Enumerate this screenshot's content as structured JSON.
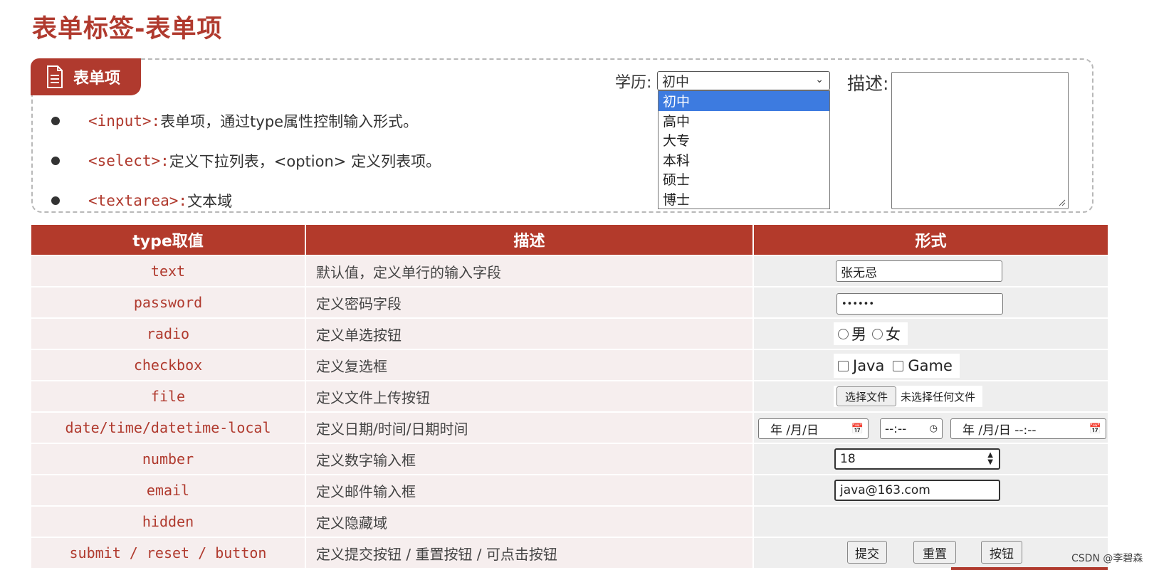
{
  "page_title": "表单标签-表单项",
  "panel": {
    "tab_label": "表单项",
    "bullets": [
      {
        "code": "<input>:",
        "text": " 表单项，通过type属性控制输入形式。"
      },
      {
        "code": "<select>:",
        "text": " 定义下拉列表，<option> 定义列表项。"
      },
      {
        "code": "<textarea>:",
        "text": " 文本域"
      }
    ],
    "select_label": "学历:",
    "select_value": "初中",
    "select_options": [
      "初中",
      "高中",
      "大专",
      "本科",
      "硕士",
      "博士"
    ],
    "textarea_label": "描述:"
  },
  "table": {
    "headers": [
      "type取值",
      "描述",
      "形式"
    ],
    "rows": [
      {
        "type": "text",
        "desc": "默认值，定义单行的输入字段"
      },
      {
        "type": "password",
        "desc": "定义密码字段"
      },
      {
        "type": "radio",
        "desc": "定义单选按钮"
      },
      {
        "type": "checkbox",
        "desc": "定义复选框"
      },
      {
        "type": "file",
        "desc": "定义文件上传按钮"
      },
      {
        "type": "date/time/datetime-local",
        "desc": "定义日期/时间/日期时间"
      },
      {
        "type": "number",
        "desc": "定义数字输入框"
      },
      {
        "type": "email",
        "desc": "定义邮件输入框"
      },
      {
        "type": "hidden",
        "desc": "定义隐藏域"
      },
      {
        "type": "submit / reset / button",
        "desc": "定义提交按钮 / 重置按钮 / 可点击按钮"
      }
    ],
    "demo": {
      "text_value": "张无忌",
      "password_mask": "••••••",
      "radio_options": [
        "男",
        "女"
      ],
      "checkbox_options": [
        "Java",
        "Game"
      ],
      "file_button": "选择文件",
      "file_status": "未选择任何文件",
      "date_placeholder": "年 /月/日",
      "time_placeholder": "--:--",
      "datetime_placeholder": "年 /月/日 --:--",
      "number_value": "18",
      "email_value": "java@163.com",
      "submit_label": "提交",
      "reset_label": "重置",
      "button_label": "按钮"
    }
  },
  "watermark": "CSDN @李碧森",
  "colors": {
    "accent": "#b03a2e",
    "header_bg": "#b33a2b",
    "row_bg": "#f6eeee",
    "select_highlight": "#3d7be0"
  }
}
